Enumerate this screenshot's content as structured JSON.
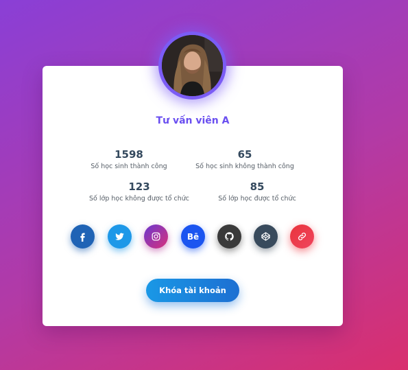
{
  "profile": {
    "name": "Tư vấn viên A"
  },
  "stats": [
    {
      "value": "1598",
      "label": "Số học sinh thành công"
    },
    {
      "value": "65",
      "label": "Số học sinh không thành công"
    },
    {
      "value": "123",
      "label": "Số lớp học không được tổ chức"
    },
    {
      "value": "85",
      "label": "Số lớp học được tổ chức"
    }
  ],
  "social": [
    {
      "icon": "facebook-icon",
      "color": "#1f63b5"
    },
    {
      "icon": "twitter-icon",
      "color": "#1d98e8"
    },
    {
      "icon": "instagram-icon",
      "color": "#c13584"
    },
    {
      "icon": "behance-icon",
      "glyph": "Bē",
      "color": "#1b55f0"
    },
    {
      "icon": "github-icon",
      "color": "#3a3a3a"
    },
    {
      "icon": "codepen-icon",
      "color": "#384a5c"
    },
    {
      "icon": "link-icon",
      "color": "#e9343c"
    }
  ],
  "actions": {
    "lock_label": "Khóa tài khoản"
  },
  "colors": {
    "accent": "#6a4ff0",
    "button": "#1a98e6"
  }
}
